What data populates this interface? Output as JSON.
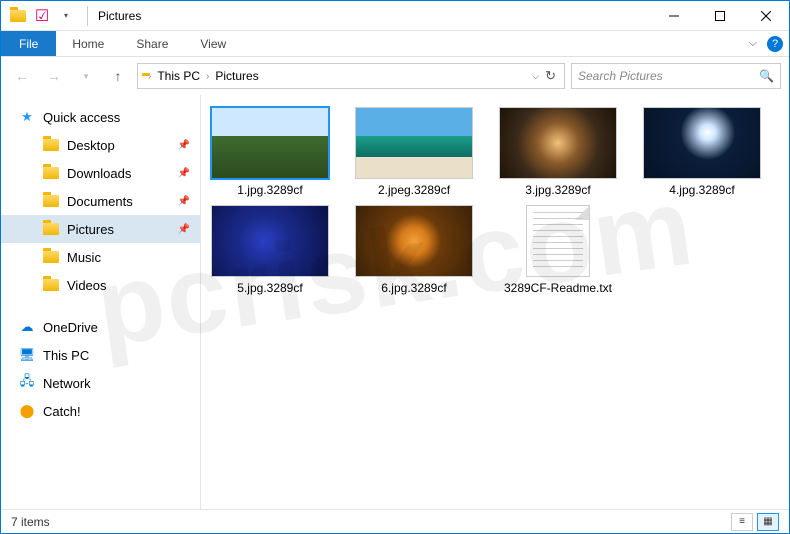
{
  "title": "Pictures",
  "ribbon": {
    "file": "File",
    "tabs": [
      "Home",
      "Share",
      "View"
    ]
  },
  "breadcrumbs": [
    {
      "label": "This PC"
    },
    {
      "label": "Pictures"
    }
  ],
  "search_placeholder": "Search Pictures",
  "sidebar": {
    "quick_access": {
      "label": "Quick access"
    },
    "quick_items": [
      {
        "label": "Desktop",
        "pinned": true
      },
      {
        "label": "Downloads",
        "pinned": true
      },
      {
        "label": "Documents",
        "pinned": true
      },
      {
        "label": "Pictures",
        "pinned": true,
        "selected": true
      },
      {
        "label": "Music",
        "pinned": false
      },
      {
        "label": "Videos",
        "pinned": false
      }
    ],
    "roots": [
      {
        "label": "OneDrive",
        "icon": "cloud"
      },
      {
        "label": "This PC",
        "icon": "pc"
      },
      {
        "label": "Network",
        "icon": "network"
      },
      {
        "label": "Catch!",
        "icon": "catch"
      }
    ]
  },
  "files": [
    {
      "name": "1.jpg.3289cf",
      "kind": "img",
      "selected": true,
      "thumb": "meadow"
    },
    {
      "name": "2.jpeg.3289cf",
      "kind": "img",
      "thumb": "beach"
    },
    {
      "name": "3.jpg.3289cf",
      "kind": "img",
      "thumb": "sphere"
    },
    {
      "name": "4.jpg.3289cf",
      "kind": "img",
      "thumb": "moon"
    },
    {
      "name": "5.jpg.3289cf",
      "kind": "img",
      "thumb": "rose"
    },
    {
      "name": "6.jpg.3289cf",
      "kind": "img",
      "thumb": "leaf"
    },
    {
      "name": "3289CF-Readme.txt",
      "kind": "txt"
    }
  ],
  "status": "7 items",
  "watermark": "pcrisk.com"
}
